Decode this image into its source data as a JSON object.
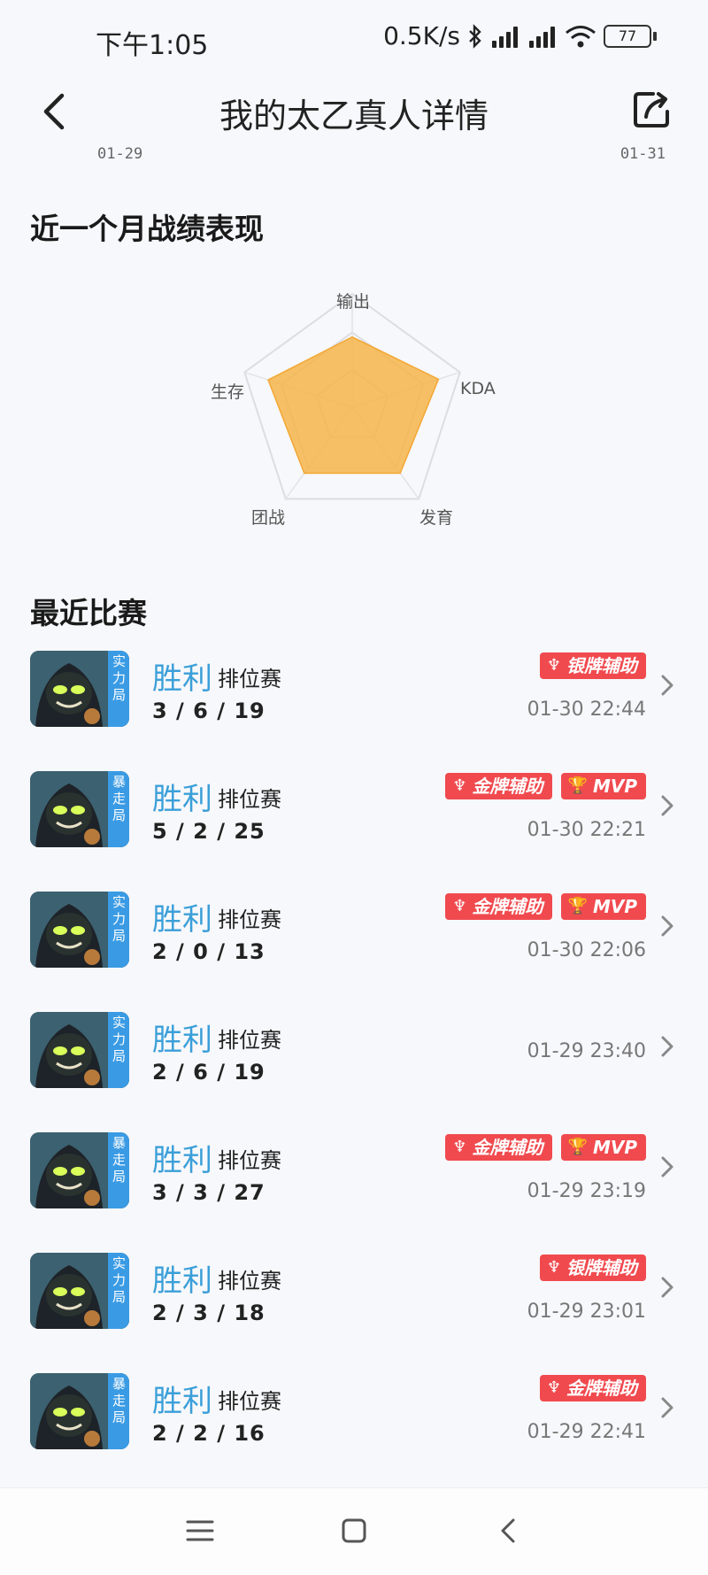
{
  "status": {
    "time": "下午1:05",
    "net_speed": "0.5K/s",
    "battery": "77"
  },
  "header": {
    "title": "我的太乙真人详情",
    "date_start": "01-29",
    "date_end": "01-31"
  },
  "performance": {
    "section_title": "近一个月战绩表现",
    "axes": [
      "输出",
      "KDA",
      "发育",
      "团战",
      "生存"
    ],
    "values": [
      0.62,
      0.8,
      0.72,
      0.72,
      0.78
    ]
  },
  "recent": {
    "section_title": "最近比赛",
    "matches": [
      {
        "mode": "实力局",
        "result": "胜利",
        "type": "排位赛",
        "kda": "3 / 6 / 19",
        "time": "01-30 22:44",
        "badges": [
          "银牌辅助"
        ]
      },
      {
        "mode": "暴走局",
        "result": "胜利",
        "type": "排位赛",
        "kda": "5 / 2 / 25",
        "time": "01-30 22:21",
        "badges": [
          "金牌辅助",
          "MVP"
        ]
      },
      {
        "mode": "实力局",
        "result": "胜利",
        "type": "排位赛",
        "kda": "2 / 0 / 13",
        "time": "01-30 22:06",
        "badges": [
          "金牌辅助",
          "MVP"
        ]
      },
      {
        "mode": "实力局",
        "result": "胜利",
        "type": "排位赛",
        "kda": "2 / 6 / 19",
        "time": "01-29 23:40",
        "badges": []
      },
      {
        "mode": "暴走局",
        "result": "胜利",
        "type": "排位赛",
        "kda": "3 / 3 / 27",
        "time": "01-29 23:19",
        "badges": [
          "金牌辅助",
          "MVP"
        ]
      },
      {
        "mode": "实力局",
        "result": "胜利",
        "type": "排位赛",
        "kda": "2 / 3 / 18",
        "time": "01-29 23:01",
        "badges": [
          "银牌辅助"
        ]
      },
      {
        "mode": "暴走局",
        "result": "胜利",
        "type": "排位赛",
        "kda": "2 / 2 / 16",
        "time": "01-29 22:41",
        "badges": [
          "金牌辅助"
        ]
      }
    ]
  },
  "colors": {
    "accent": "#3b9fd9",
    "badge": "#f04a4f",
    "radar_fill": "#f6b54b",
    "mode_tag": "#3a9be4"
  }
}
